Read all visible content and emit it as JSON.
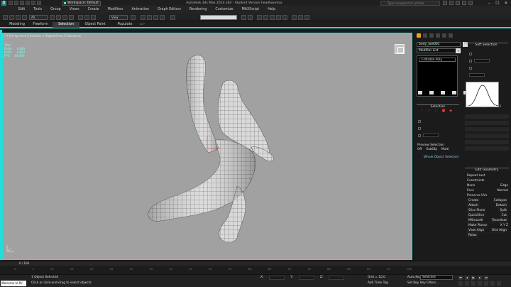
{
  "titlebar": {
    "app_logo": "3",
    "workspace": "Workspace: Default",
    "title": "Autodesk 3ds Max  2014 x64   - Student Version   headlow.max",
    "search_placeholder": "Type a keyword or phrase",
    "window_controls": [
      "‒",
      "☐",
      "✕"
    ]
  },
  "menu": {
    "logo": "3",
    "items": [
      "Edit",
      "Tools",
      "Group",
      "Views",
      "Create",
      "Modifiers",
      "Animation",
      "Graph Editors",
      "Rendering",
      "Customize",
      "MAXScript",
      "Help"
    ]
  },
  "toolbar": {
    "selection_filter": "All",
    "reference_coord": "View"
  },
  "ribbon": {
    "tabs": [
      "Modeling",
      "Freeform",
      "Selection",
      "Object Paint",
      "Populate"
    ],
    "active_tab": "Selection",
    "toggle": "▭◦"
  },
  "viewport": {
    "label": "[+] [Perspective] [Realistic + Edged Faces] [Standard]",
    "stats": [
      {
        "name": "Total",
        "value": ""
      },
      {
        "name": "Polys:",
        "value": "4,848"
      },
      {
        "name": "Verts:",
        "value": "4,864"
      },
      {
        "name": "FPS:",
        "value": "68.900"
      }
    ]
  },
  "command_panel": {
    "object_name": "body_low001",
    "object_color": "#dddddd",
    "modifier_list": "Modifier List",
    "stack_item": "Editable Poly",
    "soft_selection": "Soft Selection",
    "curve_values": [
      "43.2",
      "0.0",
      "43.2"
    ],
    "selection_rollout": "Selection",
    "preview_selection": "Preview Selection",
    "preview_options": [
      "Off",
      "SubObj",
      "Multi"
    ],
    "whole_object": "Whole Object Selected",
    "edit_geometry": "Edit Geometry",
    "repeat_last": "Repeat Last",
    "constraints": "Constraints",
    "constraint_opts": [
      "None",
      "Edge",
      "Face",
      "Normal"
    ],
    "preserve_uvs": "Preserve UVs",
    "create": "Create",
    "collapse": "Collapse",
    "attach": "Attach",
    "detach": "Detach",
    "slice_plane": "Slice Plane",
    "split": "Split",
    "quickslice": "QuickSlice",
    "cut": "Cut",
    "msmooth": "MSmooth",
    "tessellate": "Tessellate",
    "make_planar": "Make Planar",
    "xyz": [
      "X",
      "Y",
      "Z"
    ],
    "view_align": "View Align",
    "grid_align": "Grid Align",
    "relax": "Relax"
  },
  "timeline": {
    "frame_counter": "0 / 100",
    "ticks": [
      "0",
      "5",
      "10",
      "15",
      "20",
      "25",
      "30",
      "35",
      "40",
      "45",
      "50",
      "55",
      "60",
      "65",
      "70",
      "75",
      "80",
      "85",
      "90",
      "95",
      "100"
    ]
  },
  "status": {
    "maxscript": "Welcome to M/",
    "selected": "1 Object Selected",
    "prompt": "Click or click-and-drag to select objects",
    "x_label": "X:",
    "y_label": "Y:",
    "z_label": "Z:",
    "grid": "Grid = 10.0",
    "add_time_tag": "Add Time Tag",
    "auto_key": "Auto Key",
    "set_key": "Set Key",
    "key_mode": "Selected",
    "key_filters": "Key Filters...",
    "frame_value": "0",
    "accent_color": "#22dddd"
  }
}
